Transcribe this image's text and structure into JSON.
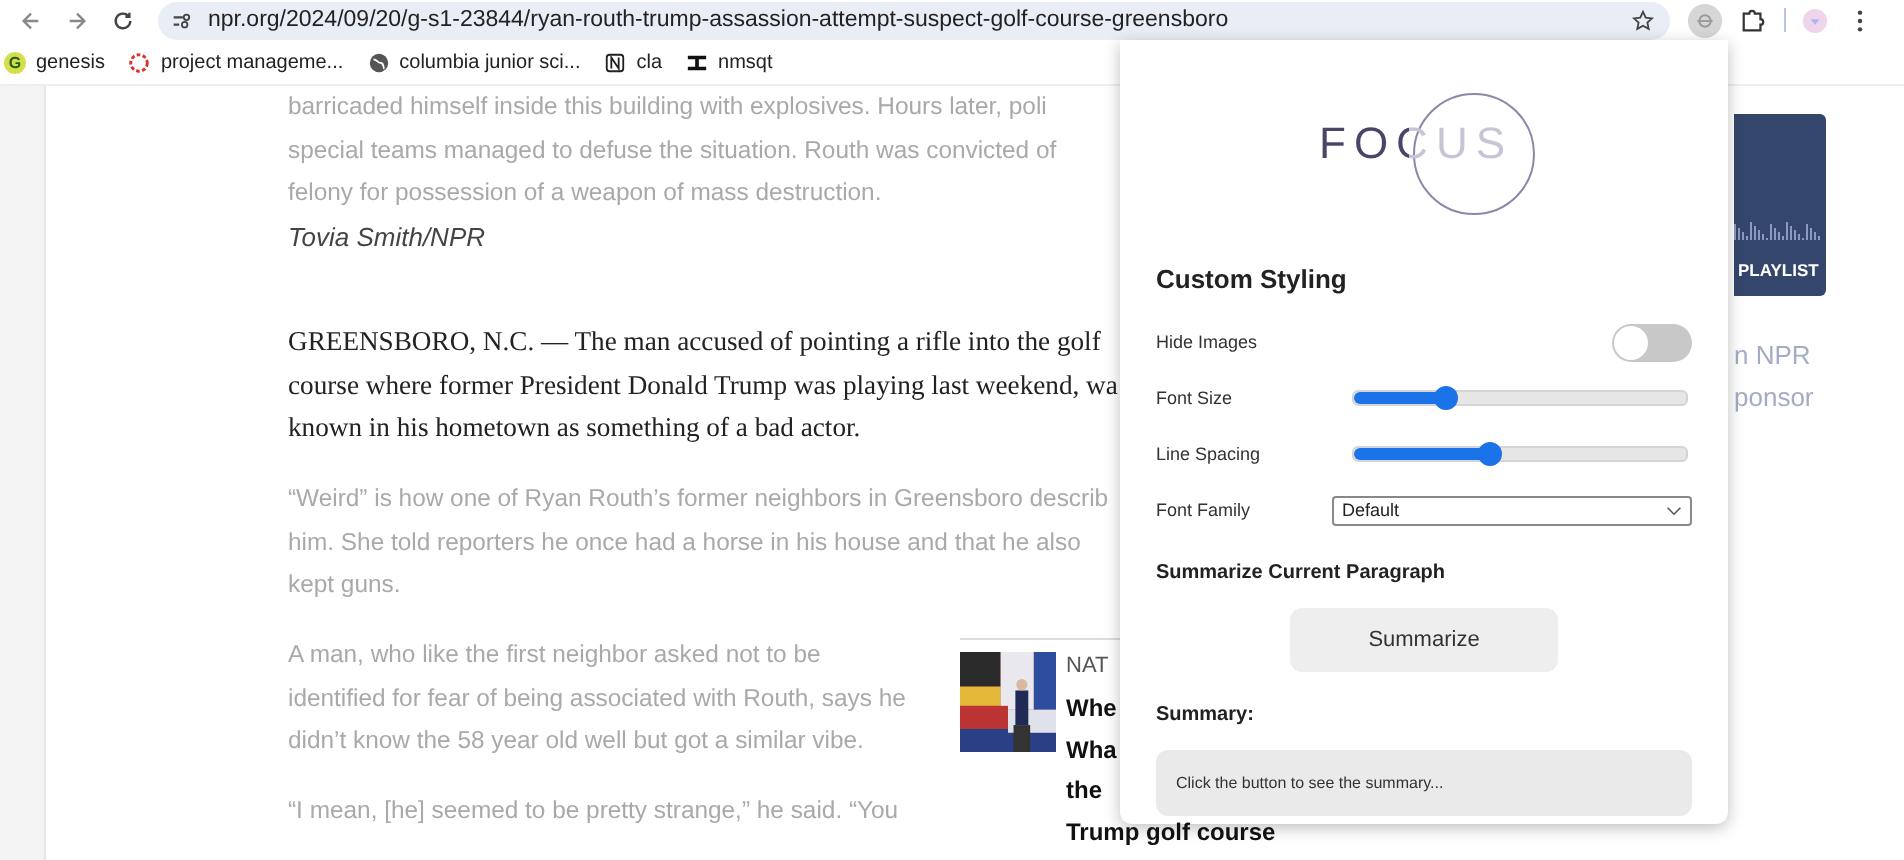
{
  "browser": {
    "url": "npr.org/2024/09/20/g-s1-23844/ryan-routh-trump-assassion-attempt-suspect-golf-course-greensboro"
  },
  "bookmarks": [
    {
      "label": "genesis",
      "kind": "letter",
      "icon_text": "G"
    },
    {
      "label": "project manageme...",
      "kind": "ring"
    },
    {
      "label": "columbia junior sci...",
      "kind": "globe"
    },
    {
      "label": "cla",
      "kind": "notion"
    },
    {
      "label": "nmsqt",
      "kind": "beam"
    }
  ],
  "article": {
    "paragraphs": [
      {
        "kind": "faded",
        "lines": [
          "barricaded himself inside this building with explosives. Hours later, poli",
          "special teams managed to defuse the situation. Routh was convicted of",
          "felony for possession of a weapon of mass destruction."
        ]
      },
      {
        "kind": "credit",
        "lines": [
          "Tovia Smith/NPR"
        ]
      },
      {
        "kind": "body",
        "lines": [
          "GREENSBORO, N.C. — The man accused of pointing a rifle into the golf",
          "course where former President Donald Trump was playing last weekend, wa",
          "known in his hometown as something of a bad actor."
        ]
      },
      {
        "kind": "faded",
        "lines": [
          "“Weird” is how one of Ryan Routh’s former neighbors in Greensboro describ",
          "him. She told reporters he once had a horse in his house and that he also",
          "kept guns."
        ]
      },
      {
        "kind": "faded",
        "lines": [
          "A man, who like the first neighbor asked not to be",
          "identified for fear of being associated with Routh, says he",
          "didn’t know the 58 year old well but got a similar vibe."
        ]
      },
      {
        "kind": "faded",
        "lines": [
          "“I mean, [he] seemed to be pretty strange,” he said. “You"
        ]
      }
    ],
    "related": {
      "section": "NAT",
      "title_lines": [
        "Whe",
        "Wha",
        "the",
        "Trump golf course"
      ]
    }
  },
  "sidebar": {
    "card_label": "PLAYLIST",
    "faded_lines": [
      "n NPR",
      "ponsor"
    ]
  },
  "popup": {
    "logo": "FOCUS",
    "heading": "Custom Styling",
    "settings": [
      {
        "kind": "toggle",
        "label": "Hide Images",
        "on": false
      },
      {
        "kind": "slider",
        "label": "Font Size",
        "level": 0.28
      },
      {
        "kind": "slider",
        "label": "Line Spacing",
        "level": 0.41
      },
      {
        "kind": "select",
        "label": "Font Family",
        "value": "Default"
      }
    ],
    "summarize_heading": "Summarize Current Paragraph",
    "summarize_button": "Summarize",
    "summary_label": "Summary:",
    "summary_text": "Click the button to see the summary..."
  }
}
